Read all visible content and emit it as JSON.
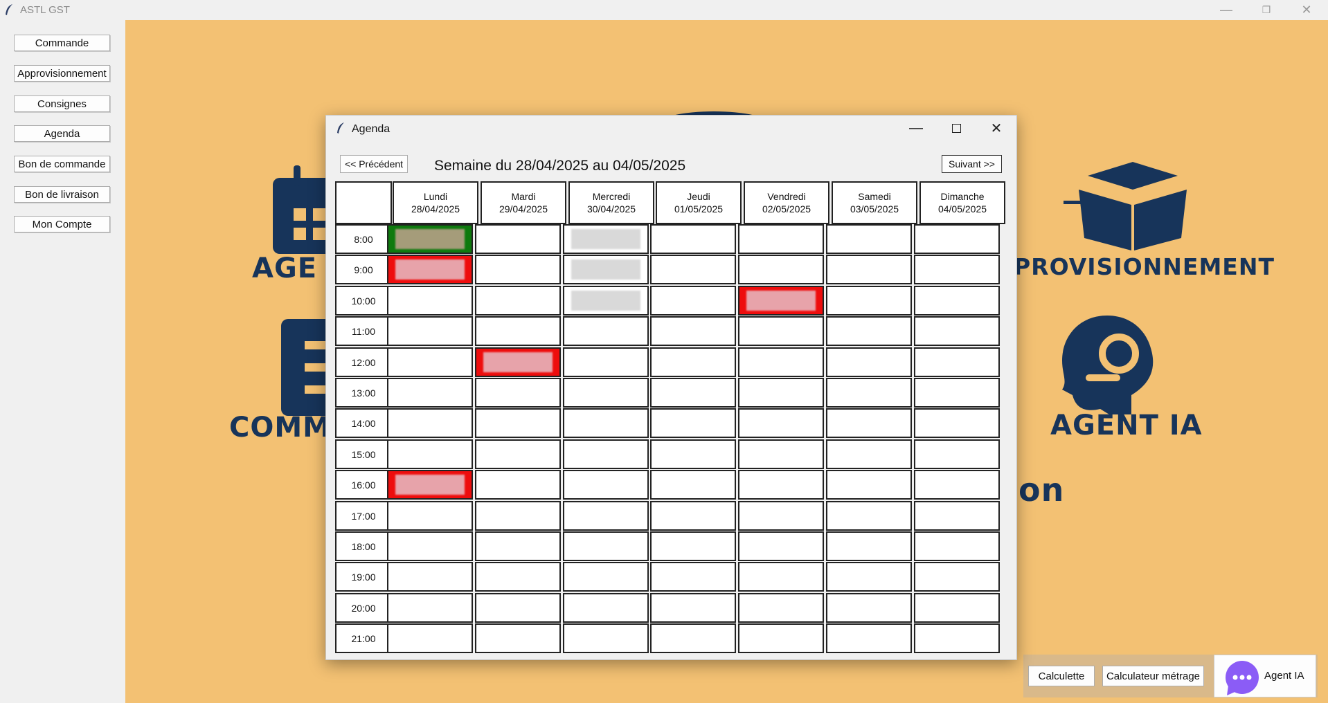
{
  "app": {
    "title": "ASTL GST"
  },
  "sidebar": {
    "items": [
      {
        "label": "Commande"
      },
      {
        "label": "Approvisionnement"
      },
      {
        "label": "Consignes"
      },
      {
        "label": "Agenda"
      },
      {
        "label": "Bon de commande"
      },
      {
        "label": "Bon de livraison"
      },
      {
        "label": "Mon Compte"
      }
    ]
  },
  "background": {
    "labels": [
      "AGE",
      "PROVISIONNEMENT",
      "COMM",
      "AGENT IA",
      "on"
    ],
    "color": "#f3c173",
    "icon_color": "#17345a"
  },
  "tools": {
    "calculette": "Calculette",
    "metrage": "Calculateur métrage",
    "agent": "Agent IA",
    "agent_icon": "chat-bubble-icon",
    "agent_icon_color": "#8b5cf6"
  },
  "agenda": {
    "window_title": "Agenda",
    "prev": "<< Précédent",
    "next": "Suivant >>",
    "week_label": "Semaine du 28/04/2025 au 04/05/2025",
    "days": [
      {
        "name": "Lundi",
        "date": "28/04/2025"
      },
      {
        "name": "Mardi",
        "date": "29/04/2025"
      },
      {
        "name": "Mercredi",
        "date": "30/04/2025"
      },
      {
        "name": "Jeudi",
        "date": "01/05/2025"
      },
      {
        "name": "Vendredi",
        "date": "02/05/2025"
      },
      {
        "name": "Samedi",
        "date": "03/05/2025"
      },
      {
        "name": "Dimanche",
        "date": "04/05/2025"
      }
    ],
    "hours": [
      "8:00",
      "9:00",
      "10:00",
      "11:00",
      "12:00",
      "13:00",
      "14:00",
      "15:00",
      "16:00",
      "17:00",
      "18:00",
      "19:00",
      "20:00",
      "21:00"
    ],
    "events": [
      {
        "day": 0,
        "hour": 0,
        "status": "green"
      },
      {
        "day": 0,
        "hour": 1,
        "status": "red"
      },
      {
        "day": 2,
        "hour": 0,
        "status": "grey"
      },
      {
        "day": 2,
        "hour": 1,
        "status": "grey"
      },
      {
        "day": 2,
        "hour": 2,
        "status": "grey"
      },
      {
        "day": 4,
        "hour": 2,
        "status": "red"
      },
      {
        "day": 1,
        "hour": 4,
        "status": "red"
      },
      {
        "day": 0,
        "hour": 8,
        "status": "red"
      }
    ],
    "status_colors": {
      "green": "#0e7a0e",
      "red": "#ee0d0d",
      "grey": "#ffffff"
    }
  }
}
